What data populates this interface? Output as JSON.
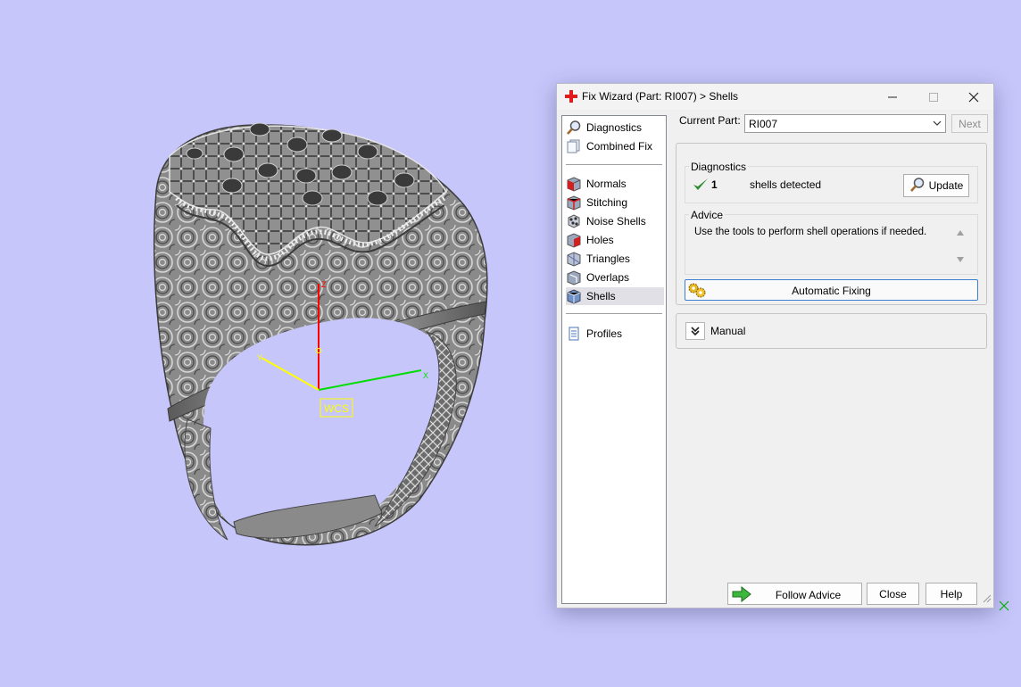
{
  "viewport": {
    "axis_labels": {
      "z": "Z",
      "x": "X",
      "y": "Y"
    },
    "wcs_label": "WCS",
    "colors": {
      "background": "#c6c6fb",
      "x_axis": "#00dd00",
      "y_axis": "#ffff00",
      "z_axis": "#ff0000",
      "model": "#808080"
    }
  },
  "dialog": {
    "title": "Fix Wizard (Part: RI007) > Shells",
    "title_icon": "red-cross-icon",
    "nav": {
      "top_items": [
        {
          "label": "Diagnostics",
          "icon": "magnifier-icon"
        },
        {
          "label": "Combined Fix",
          "icon": "layers-icon"
        }
      ],
      "fix_items": [
        {
          "label": "Normals",
          "icon": "normals-cube-icon"
        },
        {
          "label": "Stitching",
          "icon": "stitching-cube-icon"
        },
        {
          "label": "Noise Shells",
          "icon": "noise-shells-icon"
        },
        {
          "label": "Holes",
          "icon": "holes-cube-icon"
        },
        {
          "label": "Triangles",
          "icon": "triangles-cube-icon"
        },
        {
          "label": "Overlaps",
          "icon": "overlaps-cube-icon"
        },
        {
          "label": "Shells",
          "icon": "shells-cube-icon",
          "selected": true
        }
      ],
      "bottom_items": [
        {
          "label": "Profiles",
          "icon": "document-icon"
        }
      ]
    },
    "current_part": {
      "label": "Current Part:",
      "value": "RI007"
    },
    "next_label": "Next",
    "diagnostics": {
      "title": "Diagnostics",
      "count": "1",
      "text": "shells detected",
      "update_label": "Update"
    },
    "advice": {
      "title": "Advice",
      "text": "Use the tools to perform shell operations if needed."
    },
    "automatic_fixing_label": "Automatic Fixing",
    "manual_label": "Manual",
    "buttons": {
      "follow_advice": "Follow Advice",
      "close": "Close",
      "help": "Help"
    }
  }
}
